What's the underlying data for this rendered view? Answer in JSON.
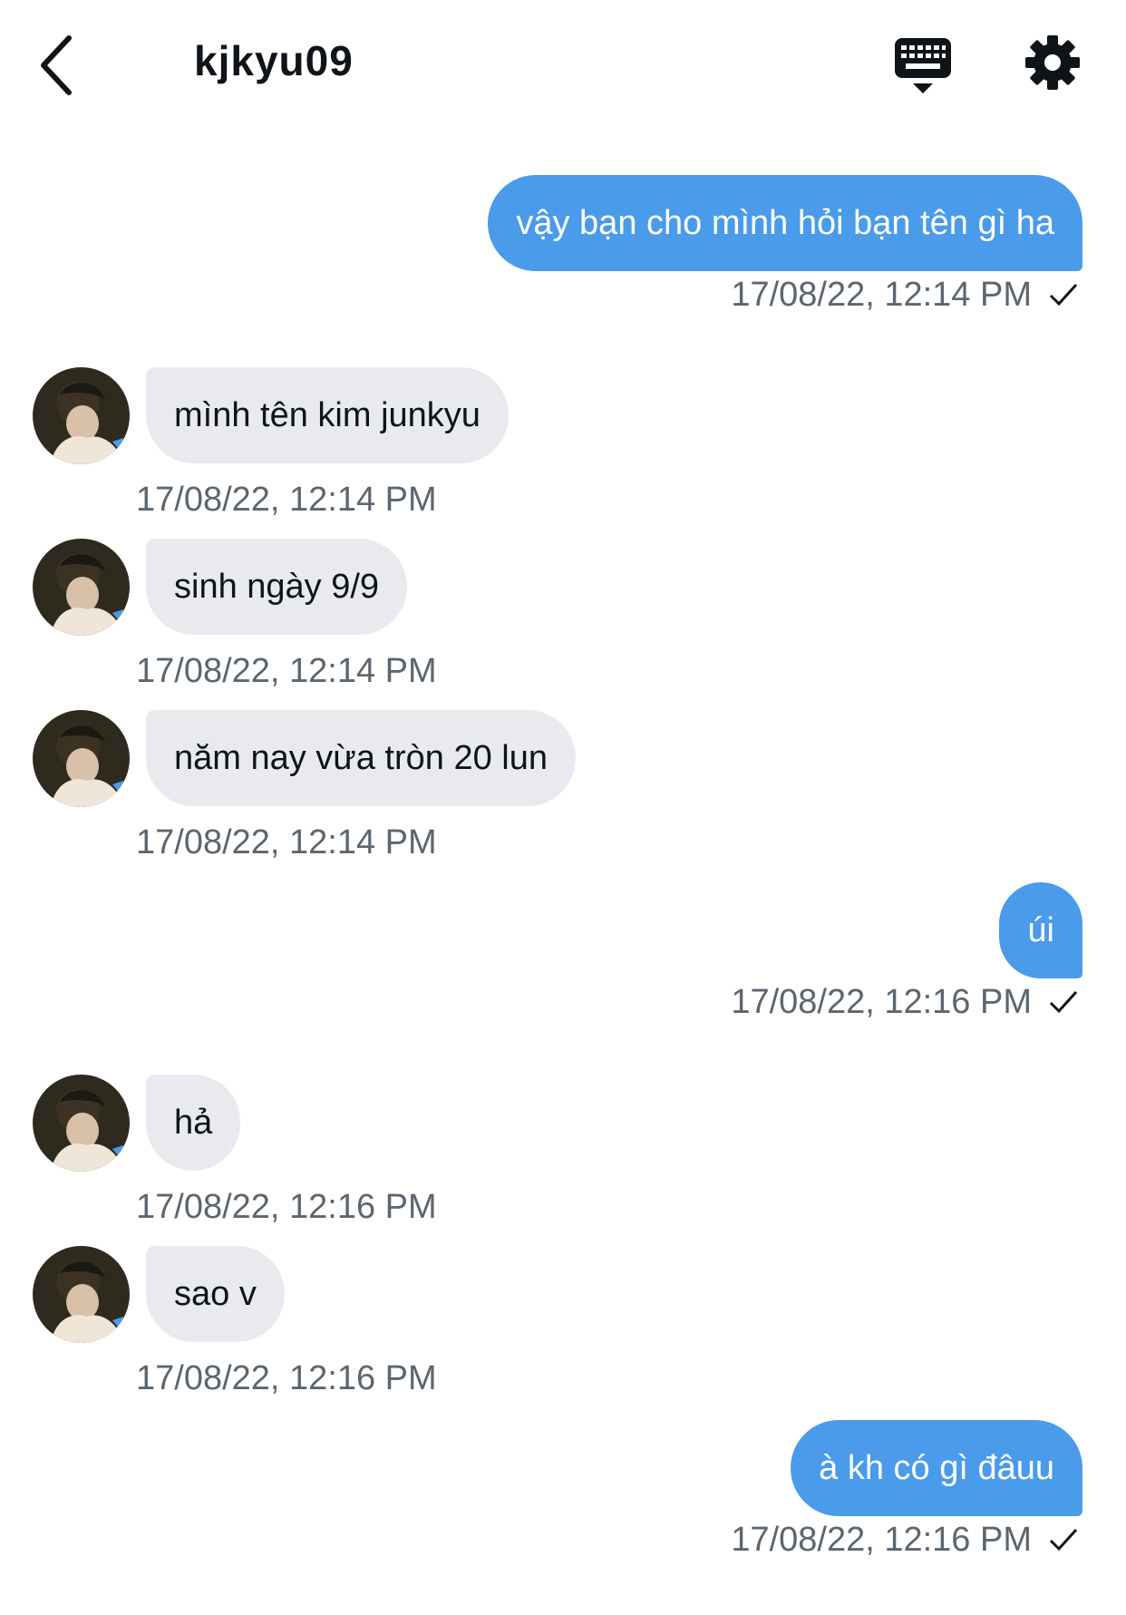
{
  "header": {
    "title": "kjkyu09",
    "back_icon": "chevron-left-icon",
    "keyboard_icon": "keyboard-icon",
    "settings_icon": "gear-icon"
  },
  "colors": {
    "outgoing_bubble": "#4a9be9",
    "incoming_bubble": "#e8eaed",
    "timestamp": "#5c6670"
  },
  "messages": [
    {
      "direction": "out",
      "text": "vậy bạn cho mình hỏi bạn tên gì ha",
      "time": "17/08/22, 12:14 PM",
      "read": true
    },
    {
      "direction": "in",
      "text": "mình tên kim junkyu",
      "time": "17/08/22, 12:14 PM"
    },
    {
      "direction": "in",
      "text": "sinh ngày 9/9",
      "time": "17/08/22, 12:14 PM"
    },
    {
      "direction": "in",
      "text": "năm nay vừa tròn 20 lun",
      "time": "17/08/22, 12:14 PM"
    },
    {
      "direction": "out",
      "text": "úi",
      "time": "17/08/22, 12:16 PM",
      "read": true
    },
    {
      "direction": "in",
      "text": "hả",
      "time": "17/08/22, 12:16 PM"
    },
    {
      "direction": "in",
      "text": "sao v",
      "time": "17/08/22, 12:16 PM"
    },
    {
      "direction": "out",
      "text": "à kh có gì đâuu",
      "time": "17/08/22, 12:16 PM",
      "read": true
    }
  ]
}
